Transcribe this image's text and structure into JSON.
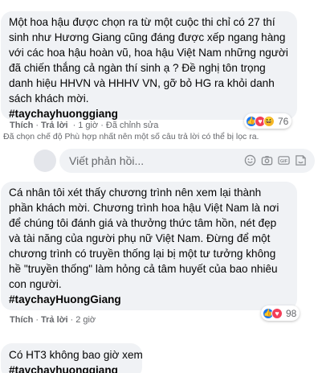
{
  "comment1": {
    "lines": [
      "Một hoa hậu được chọn ra từ một cuộc thi chỉ có 27 thí",
      "sinh như Hương Giang cũng đáng được xếp ngang hàng",
      "với các hoa hậu hoàn vũ, hoa hậu Việt Nam những người",
      "đã chiến thắng cả ngàn thí sinh ạ ? Đề nghị tôn trọng",
      "danh hiệu HHVN và HHHV VN, gỡ bỏ HG ra khỏi danh",
      "sách khách mời."
    ],
    "hashtag": "#taychayhuonggiang",
    "like_label": "Thích",
    "reply_label": "Trả lời",
    "time": "1 giờ",
    "edited_label": "Đã chỉnh sửa",
    "reaction_count": "76"
  },
  "filter_note": "Đã chọn chế độ Phù hợp nhất nên một số câu trả lời có thể bị lọc ra.",
  "reply_box": {
    "placeholder": "Viết phản hồi..."
  },
  "comment2": {
    "lines": [
      "Cá nhân tôi xét thấy chương trình nên xem lại thành",
      "phần khách mời. Chương trình hoa hậu Việt Nam là nơi",
      "để chúng tôi đánh giá và thưởng thức tâm hồn, nét đẹp",
      "và tài năng của người phụ nữ Việt Nam. Đừng để một",
      "chương trình có truyền thống lại bị một tư tưởng không",
      "hề \"truyền thống\" làm hỏng cả tâm huyết của bao nhiêu",
      "con người."
    ],
    "hashtag": "#taychayHuongGiang",
    "like_label": "Thích",
    "reply_label": "Trả lời",
    "time": "2 giờ",
    "reaction_count": "98"
  },
  "comment3": {
    "lines": [
      "Có HT3 không bao giờ xem"
    ],
    "hashtag": "#taychayhuonggiang"
  },
  "colors": {
    "bubble": "#f0f2f5",
    "meta_text": "#65676b",
    "like": "#1877f2",
    "love": "#f33e58",
    "haha": "#f7b928"
  }
}
